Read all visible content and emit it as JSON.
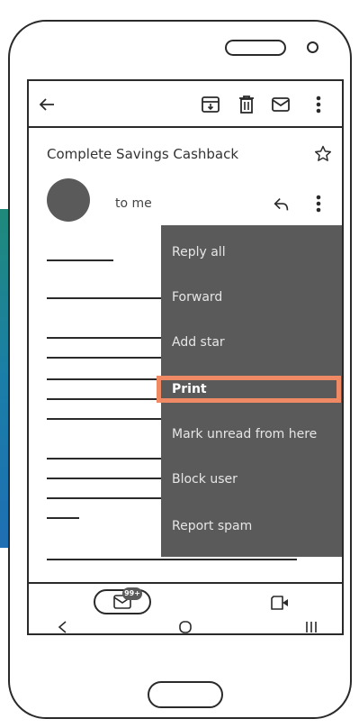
{
  "email": {
    "subject": "Complete Savings Cashback",
    "recipient": "to me"
  },
  "menu": {
    "items": [
      "Reply all",
      "Forward",
      "Add star",
      "Print",
      "Mark unread from here",
      "Block user",
      "Report spam"
    ],
    "selected": "Print"
  },
  "bottom_nav": {
    "mail_badge": "99+"
  },
  "icons": {
    "toolbar": [
      "back-arrow-icon",
      "archive-icon",
      "trash-icon",
      "mail-icon",
      "more-vertical-icon"
    ],
    "message": [
      "star-icon",
      "reply-icon",
      "more-vertical-icon"
    ],
    "nav": [
      "mail-icon",
      "video-icon",
      "back-icon",
      "home-icon",
      "recents-icon"
    ]
  },
  "colors": {
    "menu_bg": "#5a5a5a",
    "highlight": "#f08a64",
    "avatar": "#5a5a5a",
    "accent_strip": "#1a7fa8"
  }
}
